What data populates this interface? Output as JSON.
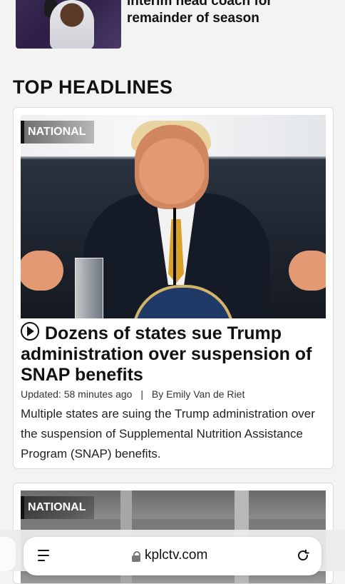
{
  "top_story": {
    "title": "interim head coach for remainder of season"
  },
  "section": {
    "title": "TOP HEADLINES"
  },
  "cards": [
    {
      "category": "NATIONAL",
      "headline": "Dozens of states sue Trump administration over suspension of SNAP benefits",
      "updated": "Updated: 58 minutes ago",
      "byline": "By Emily Van de Riet",
      "summary": "Multiple states are suing the Trump administration over the suspension of Supplemental Nutrition Assistance Program (SNAP) benefits.",
      "icon": "play-circle-icon"
    },
    {
      "category": "NATIONAL"
    }
  ],
  "browser": {
    "url": "kplctv.com",
    "icons": [
      "tabs-menu-icon",
      "lock-icon",
      "reload-icon"
    ]
  },
  "colors": {
    "badge_text": "#ffffff",
    "page_bg": "#f3f3f3",
    "card_bg": "#ffffff"
  }
}
